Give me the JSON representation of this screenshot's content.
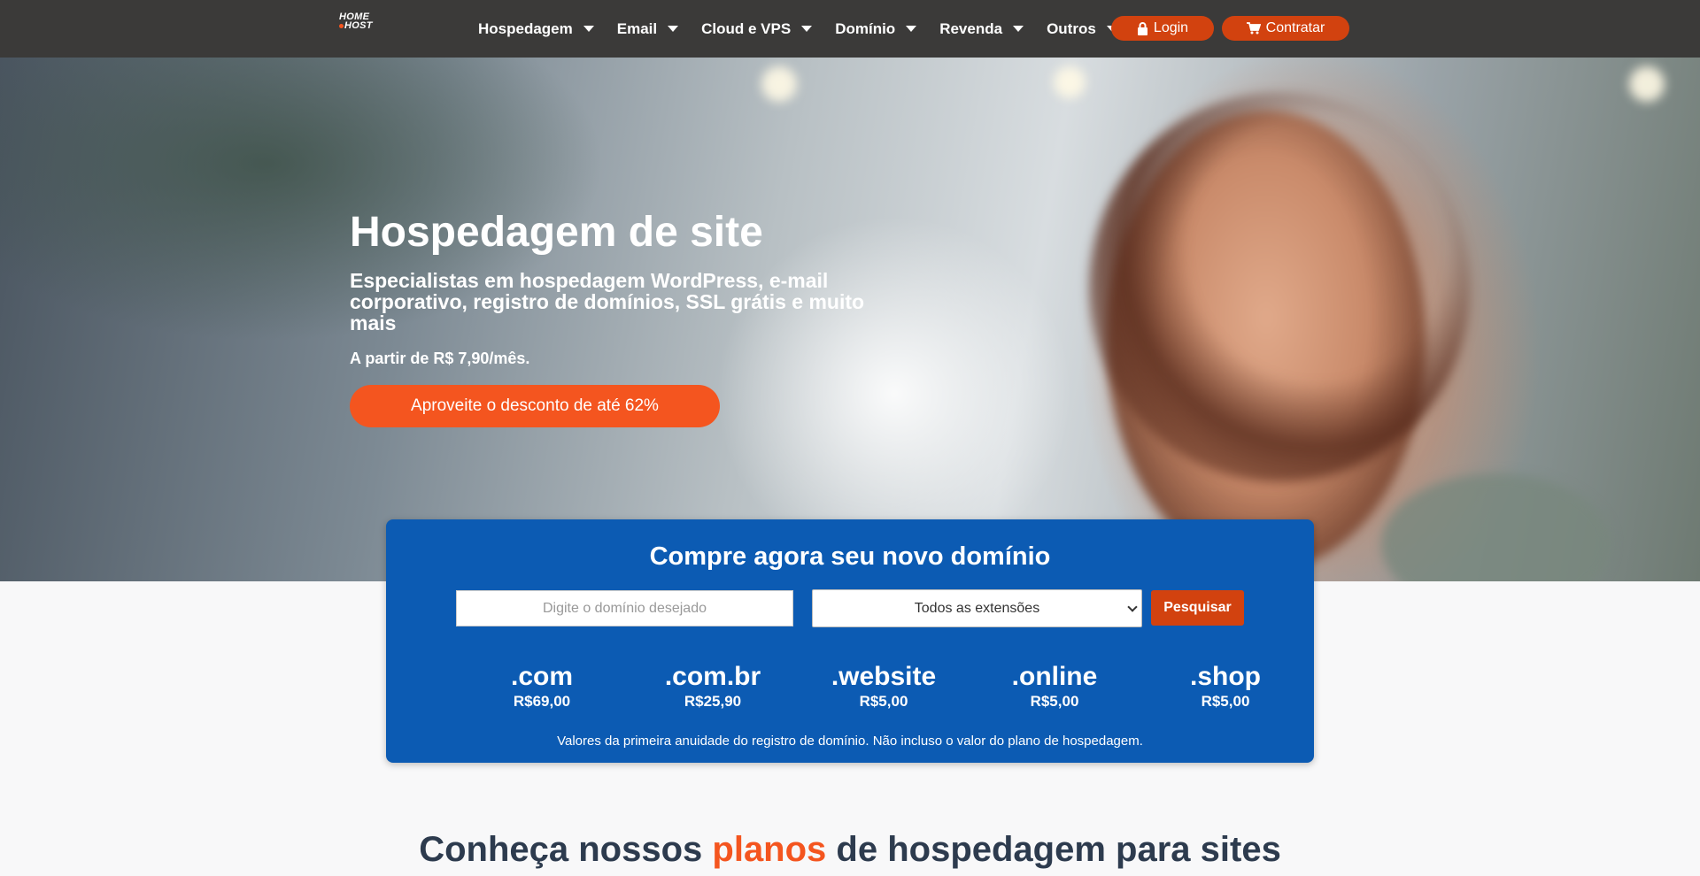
{
  "brand": {
    "logo_line1": "HOME",
    "logo_line2": "HOST"
  },
  "nav": {
    "items": [
      {
        "label": "Hospedagem"
      },
      {
        "label": "Email"
      },
      {
        "label": "Cloud e VPS"
      },
      {
        "label": "Domínio"
      },
      {
        "label": "Revenda"
      },
      {
        "label": "Outros"
      }
    ],
    "login_label": "Login",
    "contratar_label": "Contratar"
  },
  "hero": {
    "title": "Hospedagem de site",
    "subtitle": "Especialistas em hospedagem WordPress, e-mail corporativo, registro de domínios, SSL grátis e muito mais",
    "price_text": "A partir de R$ 7,90/mês.",
    "cta_label": "Aproveite o desconto de até 62%"
  },
  "domain_search": {
    "title": "Compre agora seu novo domínio",
    "input_placeholder": "Digite o domínio desejado",
    "input_value": "",
    "select_value": "Todos as extensões",
    "search_label": "Pesquisar",
    "tlds": [
      {
        "name": ".com",
        "price": "R$69,00"
      },
      {
        "name": ".com.br",
        "price": "R$25,90"
      },
      {
        "name": ".website",
        "price": "R$5,00"
      },
      {
        "name": ".online",
        "price": "R$5,00"
      },
      {
        "name": ".shop",
        "price": "R$5,00"
      }
    ],
    "note": "Valores da primeira anuidade do registro de domínio. Não incluso o valor do plano de hospedagem."
  },
  "plans": {
    "heading_pre": "Conheça nossos ",
    "heading_accent": "planos",
    "heading_post": " de hospedagem para sites"
  },
  "colors": {
    "navbar_bg": "#3b3a39",
    "accent_orange": "#f4551f",
    "button_red": "#d2420f",
    "domain_box_blue": "#0c5bb3",
    "heading_dark": "#2d3b4e"
  }
}
